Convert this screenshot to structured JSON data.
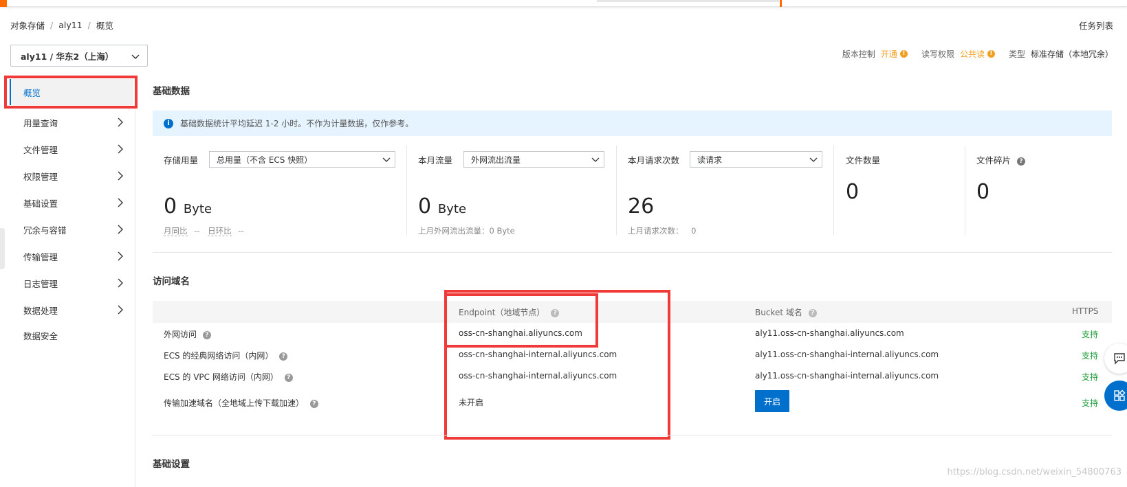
{
  "breadcrumb": [
    "对象存储",
    "aly11",
    "概览"
  ],
  "breadcrumb_sep": "/",
  "task_list": "任务列表",
  "bucket_select": "aly11 / 华东2（上海）",
  "meta": {
    "version_label": "版本控制",
    "version_value": "开通",
    "acl_label": "读写权限",
    "acl_value": "公共读",
    "type_label": "类型",
    "type_value": "标准存储（本地冗余）",
    "warn_glyph": "!"
  },
  "sidebar": {
    "items": [
      {
        "label": "概览",
        "active": true,
        "arrow": false
      },
      {
        "label": "用量查询",
        "arrow": true
      },
      {
        "label": "文件管理",
        "arrow": true
      },
      {
        "label": "权限管理",
        "arrow": true
      },
      {
        "label": "基础设置",
        "arrow": true
      },
      {
        "label": "冗余与容错",
        "arrow": true
      },
      {
        "label": "传输管理",
        "arrow": true
      },
      {
        "label": "日志管理",
        "arrow": true
      },
      {
        "label": "数据处理",
        "arrow": true
      },
      {
        "label": "数据安全",
        "arrow": false
      }
    ]
  },
  "basic_data": {
    "title": "基础数据",
    "notice": "基础数据统计平均延迟 1-2 小时。不作为计量数据，仅作参考。",
    "storage": {
      "label": "存储用量",
      "select": "总用量（不含 ECS 快照）",
      "value": "0",
      "unit": "Byte",
      "sub_mom_label": "月同比",
      "sub_mom_value": "--",
      "sub_dod_label": "日环比",
      "sub_dod_value": "--"
    },
    "traffic": {
      "label": "本月流量",
      "select": "外网流出流量",
      "value": "0",
      "unit": "Byte",
      "sub": "上月外网流出流量：0 Byte"
    },
    "requests": {
      "label": "本月请求次数",
      "select": "读请求",
      "value": "26",
      "sub_label": "上月请求次数：",
      "sub_value": "0"
    },
    "files": {
      "label": "文件数量",
      "value": "0"
    },
    "fragments": {
      "label": "文件碎片",
      "value": "0"
    }
  },
  "domains": {
    "title": "访问域名",
    "headers": {
      "endpoint": "Endpoint（地域节点）",
      "bucket": "Bucket 域名",
      "https": "HTTPS"
    },
    "rows": [
      {
        "name": "外网访问",
        "endpoint": "oss-cn-shanghai.aliyuncs.com",
        "bucket": "aly11.oss-cn-shanghai.aliyuncs.com",
        "https": "支持"
      },
      {
        "name": "ECS 的经典网络访问（内网）",
        "endpoint": "oss-cn-shanghai-internal.aliyuncs.com",
        "bucket": "aly11.oss-cn-shanghai-internal.aliyuncs.com",
        "https": "支持"
      },
      {
        "name": "ECS 的 VPC 网络访问（内网）",
        "endpoint": "oss-cn-shanghai-internal.aliyuncs.com",
        "bucket": "aly11.oss-cn-shanghai-internal.aliyuncs.com",
        "https": "支持"
      },
      {
        "name": "传输加速域名（全地域上传下载加速）",
        "endpoint": "未开启",
        "bucket_button": "开启",
        "https": "支持"
      }
    ],
    "help_glyph": "?"
  },
  "basic_settings": {
    "title": "基础设置"
  },
  "watermark": "https://blog.csdn.net/weixin_54800763",
  "colors": {
    "primary": "#0070cc",
    "warning": "#f0a020",
    "success": "#1e9e3a",
    "highlight": "#f03a3a"
  },
  "icons": {
    "info_glyph": "i"
  }
}
